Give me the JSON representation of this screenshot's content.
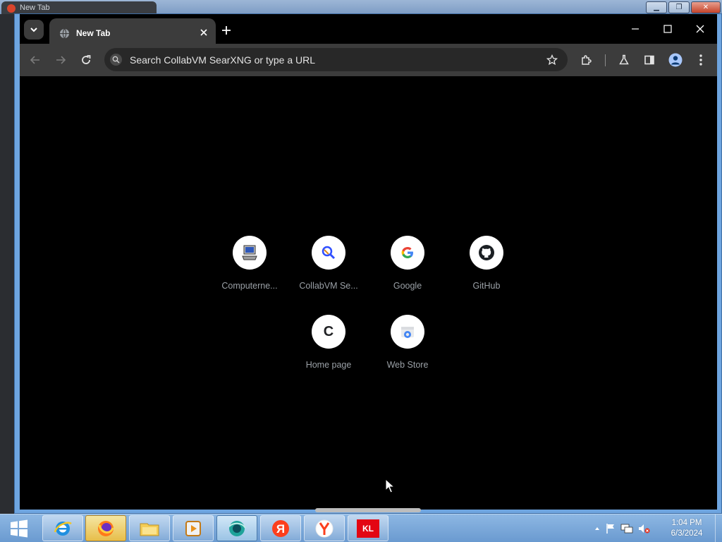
{
  "background_window": {
    "tab_label": "New Tab"
  },
  "browser": {
    "tab": {
      "title": "New Tab",
      "favicon": "globe-icon"
    },
    "omnibox": {
      "placeholder": "Search CollabVM SearXNG or type a URL"
    },
    "toolbar_icons": [
      "back-icon",
      "forward-icon",
      "reload-icon",
      "star-icon",
      "extensions-icon",
      "labs-icon",
      "side-panel-icon",
      "profile-icon",
      "menu-icon"
    ]
  },
  "shortcuts": [
    {
      "label": "Computerne...",
      "icon": "computer-icon"
    },
    {
      "label": "CollabVM Se...",
      "icon": "searxng-icon"
    },
    {
      "label": "Google",
      "icon": "google-icon"
    },
    {
      "label": "GitHub",
      "icon": "github-icon"
    },
    {
      "label": "Home page",
      "icon": "letter-c-icon",
      "letter": "C"
    },
    {
      "label": "Web Store",
      "icon": "web-store-icon"
    }
  ],
  "taskbar": {
    "apps": [
      "internet-explorer-icon",
      "firefox-icon",
      "file-explorer-icon",
      "media-player-icon",
      "browser-icon",
      "yandex-icon",
      "yandex-browser-icon",
      "kl-icon"
    ],
    "kl_label": "KL",
    "clock_time": "1:04 PM",
    "clock_date": "6/3/2024"
  }
}
